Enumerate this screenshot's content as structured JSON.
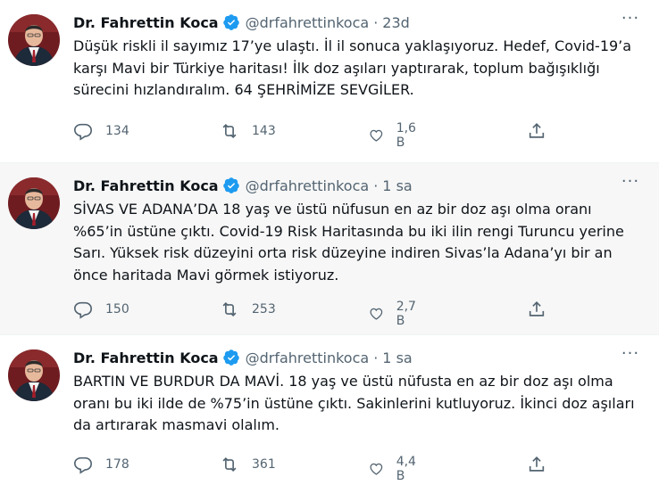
{
  "tweets": [
    {
      "author": "Dr. Fahrettin Koca",
      "handle": "@drfahrettinkoca",
      "sep": "·",
      "time": "23d",
      "text": "Düşük riskli il sayımız 17’ye ulaştı. İl il sonuca yaklaşıyoruz. Hedef, Covid-19’a karşı Mavi bir Türkiye haritası! İlk doz aşıları yaptırarak, toplum bağışıklığı sürecini hızlandıralım. 64 ŞEHRİMİZE SEVGİLER.",
      "replies": "134",
      "retweets": "143",
      "likes": "1,6 B"
    },
    {
      "author": "Dr. Fahrettin Koca",
      "handle": "@drfahrettinkoca",
      "sep": "·",
      "time": "1 sa",
      "text": "SİVAS VE ADANA’DA 18 yaş ve üstü nüfusun en az bir doz aşı olma oranı %65’in üstüne çıktı. Covid-19 Risk Haritasında bu iki ilin rengi Turuncu yerine Sarı. Yüksek risk düzeyini orta risk düzeyine indiren Sivas’la Adana’yı bir an önce haritada Mavi görmek istiyoruz.",
      "replies": "150",
      "retweets": "253",
      "likes": "2,7 B"
    },
    {
      "author": "Dr. Fahrettin Koca",
      "handle": "@drfahrettinkoca",
      "sep": "·",
      "time": "1 sa",
      "text": "BARTIN VE BURDUR DA MAVİ. 18 yaş ve üstü nüfusta en az bir doz aşı olma oranı bu iki ilde de %75’in üstüne çıktı. Sakinlerini kutluyoruz. İkinci doz aşıları da artırarak masmavi olalım.",
      "replies": "178",
      "retweets": "361",
      "likes": "4,4 B"
    }
  ],
  "colors": {
    "text": "#0f1419",
    "secondary": "#536471",
    "verified": "#1d9bf0",
    "hover_bg": "#f7f7f7",
    "border": "#eff3f4"
  },
  "icons": [
    "reply-icon",
    "retweet-icon",
    "like-icon",
    "share-icon",
    "verified-badge-icon",
    "more-icon"
  ]
}
